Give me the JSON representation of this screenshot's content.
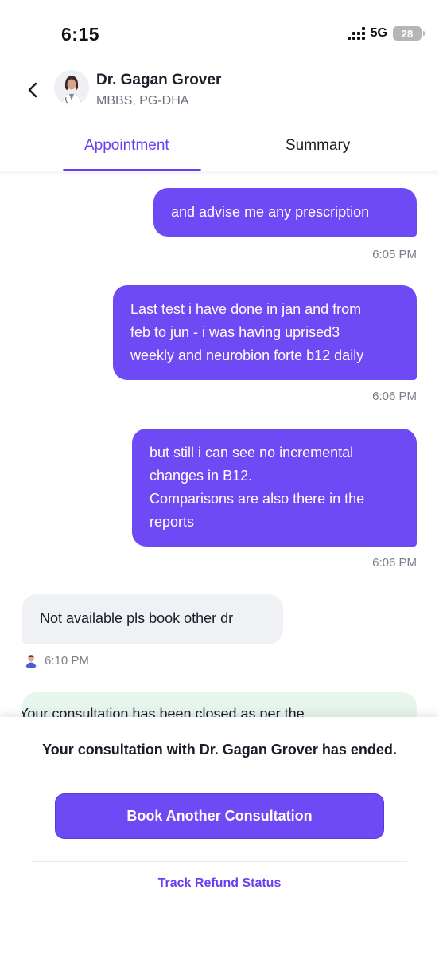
{
  "status_bar": {
    "time": "6:15",
    "network": "5G",
    "battery": "28"
  },
  "header": {
    "doctor_name": "Dr. Gagan Grover",
    "doctor_degree": "MBBS, PG-DHA",
    "tabs": [
      {
        "label": "Appointment",
        "active": true
      },
      {
        "label": "Summary",
        "active": false
      }
    ]
  },
  "messages": [
    {
      "direction": "outgoing",
      "lines": [
        "and advise me any prescription"
      ],
      "time": "6:05 PM"
    },
    {
      "direction": "outgoing",
      "lines": [
        "Last test i have done in jan and from",
        "feb to jun - i was having uprised3",
        "weekly and neurobion forte b12 daily"
      ],
      "time": "6:06 PM"
    },
    {
      "direction": "outgoing",
      "lines": [
        "but still i can see no incremental",
        "changes in B12.",
        "Comparisons are also there in the",
        "reports"
      ],
      "time": "6:06 PM"
    },
    {
      "direction": "incoming",
      "lines": [
        "Not available pls book other dr"
      ],
      "time": "6:10 PM"
    }
  ],
  "system_card": {
    "text": "Your consultation has been closed as per the"
  },
  "bottom_sheet": {
    "ended_message": "Your consultation with Dr. Gagan Grover has ended.",
    "book_button_label": "Book Another Consultation",
    "refund_link_label": "Track Refund Status"
  },
  "colors": {
    "accent": "#6e4af5",
    "tab_active": "#6a3ff2",
    "incoming_bubble": "#eff1f4",
    "system_card": "#e7f5ec"
  }
}
